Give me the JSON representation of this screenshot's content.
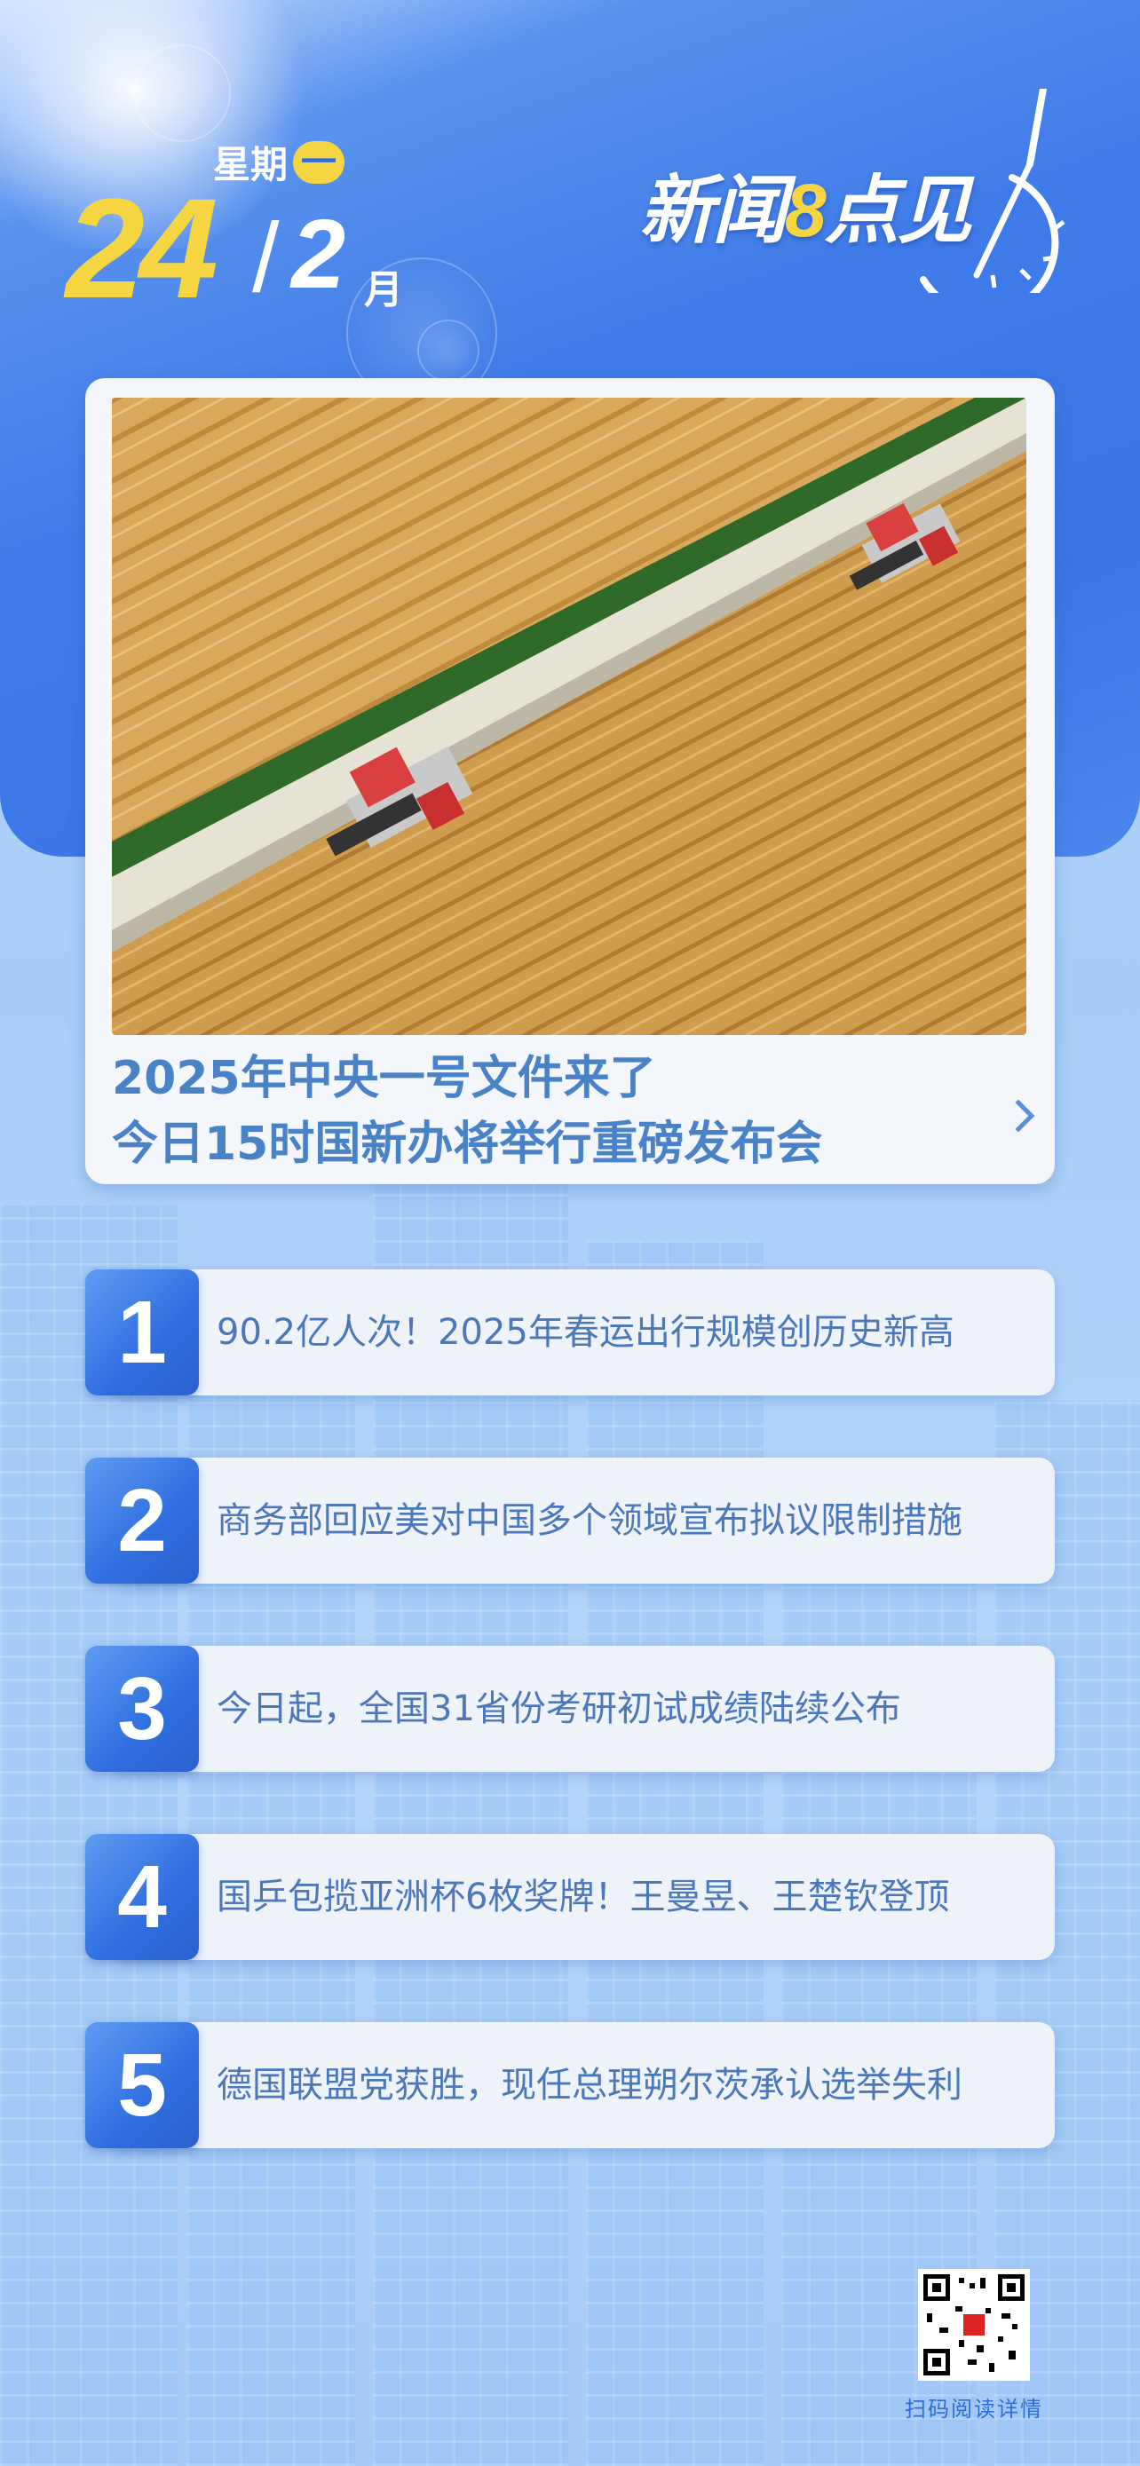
{
  "date": {
    "weekday_label": "星期",
    "weekday_num": "一",
    "day": "24",
    "slash": "/",
    "month": "2",
    "month_unit": "月"
  },
  "logo": {
    "prefix": "新闻",
    "eight": "8",
    "suffix": "点见"
  },
  "headline": {
    "line1": "2025年中央一号文件来了",
    "line2": "今日15时国新办将举行重磅发布会"
  },
  "news": [
    {
      "num": "1",
      "text": "90.2亿人次！2025年春运出行规模创历史新高"
    },
    {
      "num": "2",
      "text": "商务部回应美对中国多个领域宣布拟议限制措施"
    },
    {
      "num": "3",
      "text": "今日起，全国31省份考研初试成绩陆续公布"
    },
    {
      "num": "4",
      "text": "国乒包揽亚洲杯6枚奖牌！王曼昱、王楚钦登顶"
    },
    {
      "num": "5",
      "text": "德国联盟党获胜，现任总理朔尔茨承认选举失利"
    }
  ],
  "qr": {
    "label": "扫码阅读详情"
  },
  "colors": {
    "accent_yellow": "#f5d642",
    "brand_blue": "#3a76e6",
    "text_blue": "#4a78b8"
  }
}
